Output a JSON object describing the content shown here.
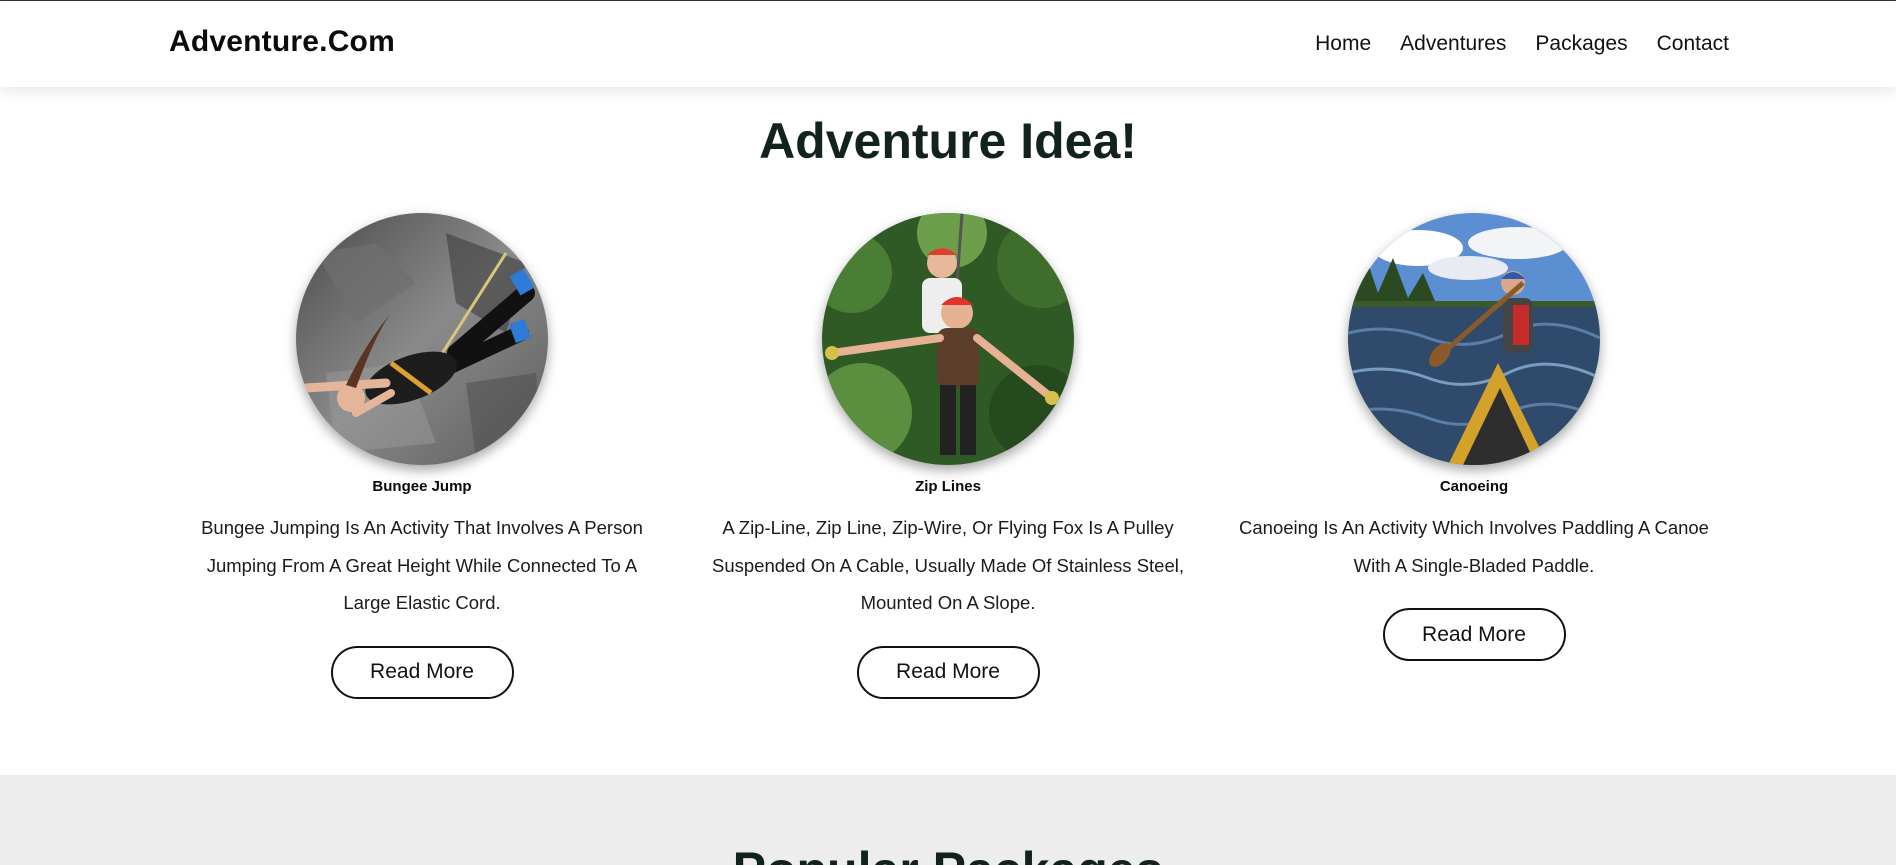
{
  "header": {
    "logo": "Adventure.Com",
    "nav": [
      "Home",
      "Adventures",
      "Packages",
      "Contact"
    ]
  },
  "ideas": {
    "title": "Adventure Idea!",
    "cards": [
      {
        "image": "bungee-jump-photo",
        "title": "Bungee Jump",
        "description": "Bungee Jumping Is An Activity That Involves A Person Jumping From A Great Height While Connected To A Large Elastic Cord.",
        "button": "Read More"
      },
      {
        "image": "zip-line-photo",
        "title": "Zip Lines",
        "description": "A Zip-Line, Zip Line, Zip-Wire, Or Flying Fox Is A Pulley Suspended On A Cable, Usually Made Of Stainless Steel, Mounted On A Slope.",
        "button": "Read More"
      },
      {
        "image": "canoeing-photo",
        "title": "Canoeing",
        "description": "Canoeing Is An Activity Which Involves Paddling A Canoe With A Single-Bladed Paddle.",
        "button": "Read More"
      }
    ]
  },
  "packages": {
    "title": "Popular Packages"
  },
  "colors": {
    "heading": "#12231d",
    "packages_bg": "#ededed"
  }
}
